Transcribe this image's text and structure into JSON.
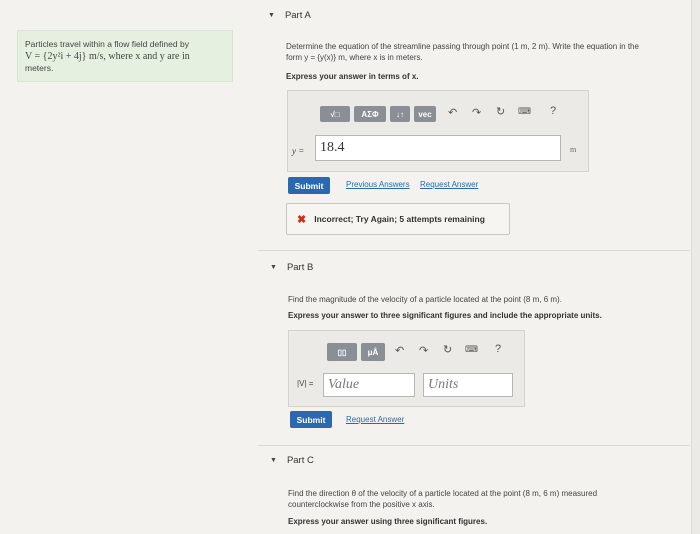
{
  "problem": {
    "intro_prefix": "Particles travel within a flow field defined by",
    "velocity_expr": "V = {2y²i + 4j} m/s, where x and y are in",
    "intro_suffix": "meters."
  },
  "part_a": {
    "header": "Part A",
    "prompt_line1": "Determine the equation of the streamline passing through point (1 m, 2 m). Write the equation in the",
    "prompt_line2": "form y = {y(x)} m, where x is in meters.",
    "instruction": "Express your answer in terms of x.",
    "toolbar": {
      "sqrt_label": "√□",
      "greek_label": "ΑΣΦ",
      "arrows_label": "↓↑",
      "vec_label": "vec",
      "help_label": "?"
    },
    "var_label": "y =",
    "answer_value": "18.4",
    "unit": "m",
    "submit_label": "Submit",
    "previous_answers": "Previous Answers",
    "request_answer": "Request Answer",
    "feedback": "Incorrect; Try Again; 5 attempts remaining"
  },
  "part_b": {
    "header": "Part B",
    "prompt": "Find the magnitude of the velocity of a particle located at the point (8 m, 6 m).",
    "instruction": "Express your answer to three significant figures and include the appropriate units.",
    "toolbar": {
      "templates_label": "▯▯",
      "units_label": "μÅ",
      "help_label": "?"
    },
    "var_label": "|V| =",
    "value_placeholder": "Value",
    "units_placeholder": "Units",
    "submit_label": "Submit",
    "request_answer": "Request Answer"
  },
  "part_c": {
    "header": "Part C",
    "prompt_line1": "Find the direction θ of the velocity of a particle located at the point (8 m, 6 m) measured",
    "prompt_line2": "counterclockwise from the positive x axis.",
    "instruction": "Express your answer using three significant figures."
  }
}
